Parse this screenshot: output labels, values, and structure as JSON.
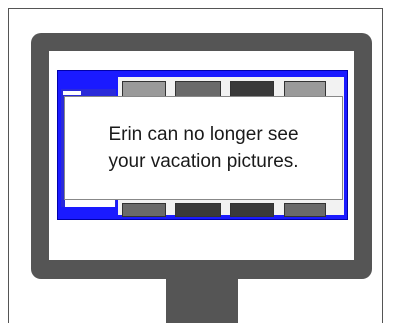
{
  "message": {
    "text": "Erin can no longer see your vacation pictures."
  },
  "colors": {
    "monitor": "#555555",
    "app_accent": "#1a1aff",
    "frame_border": "#555555"
  }
}
